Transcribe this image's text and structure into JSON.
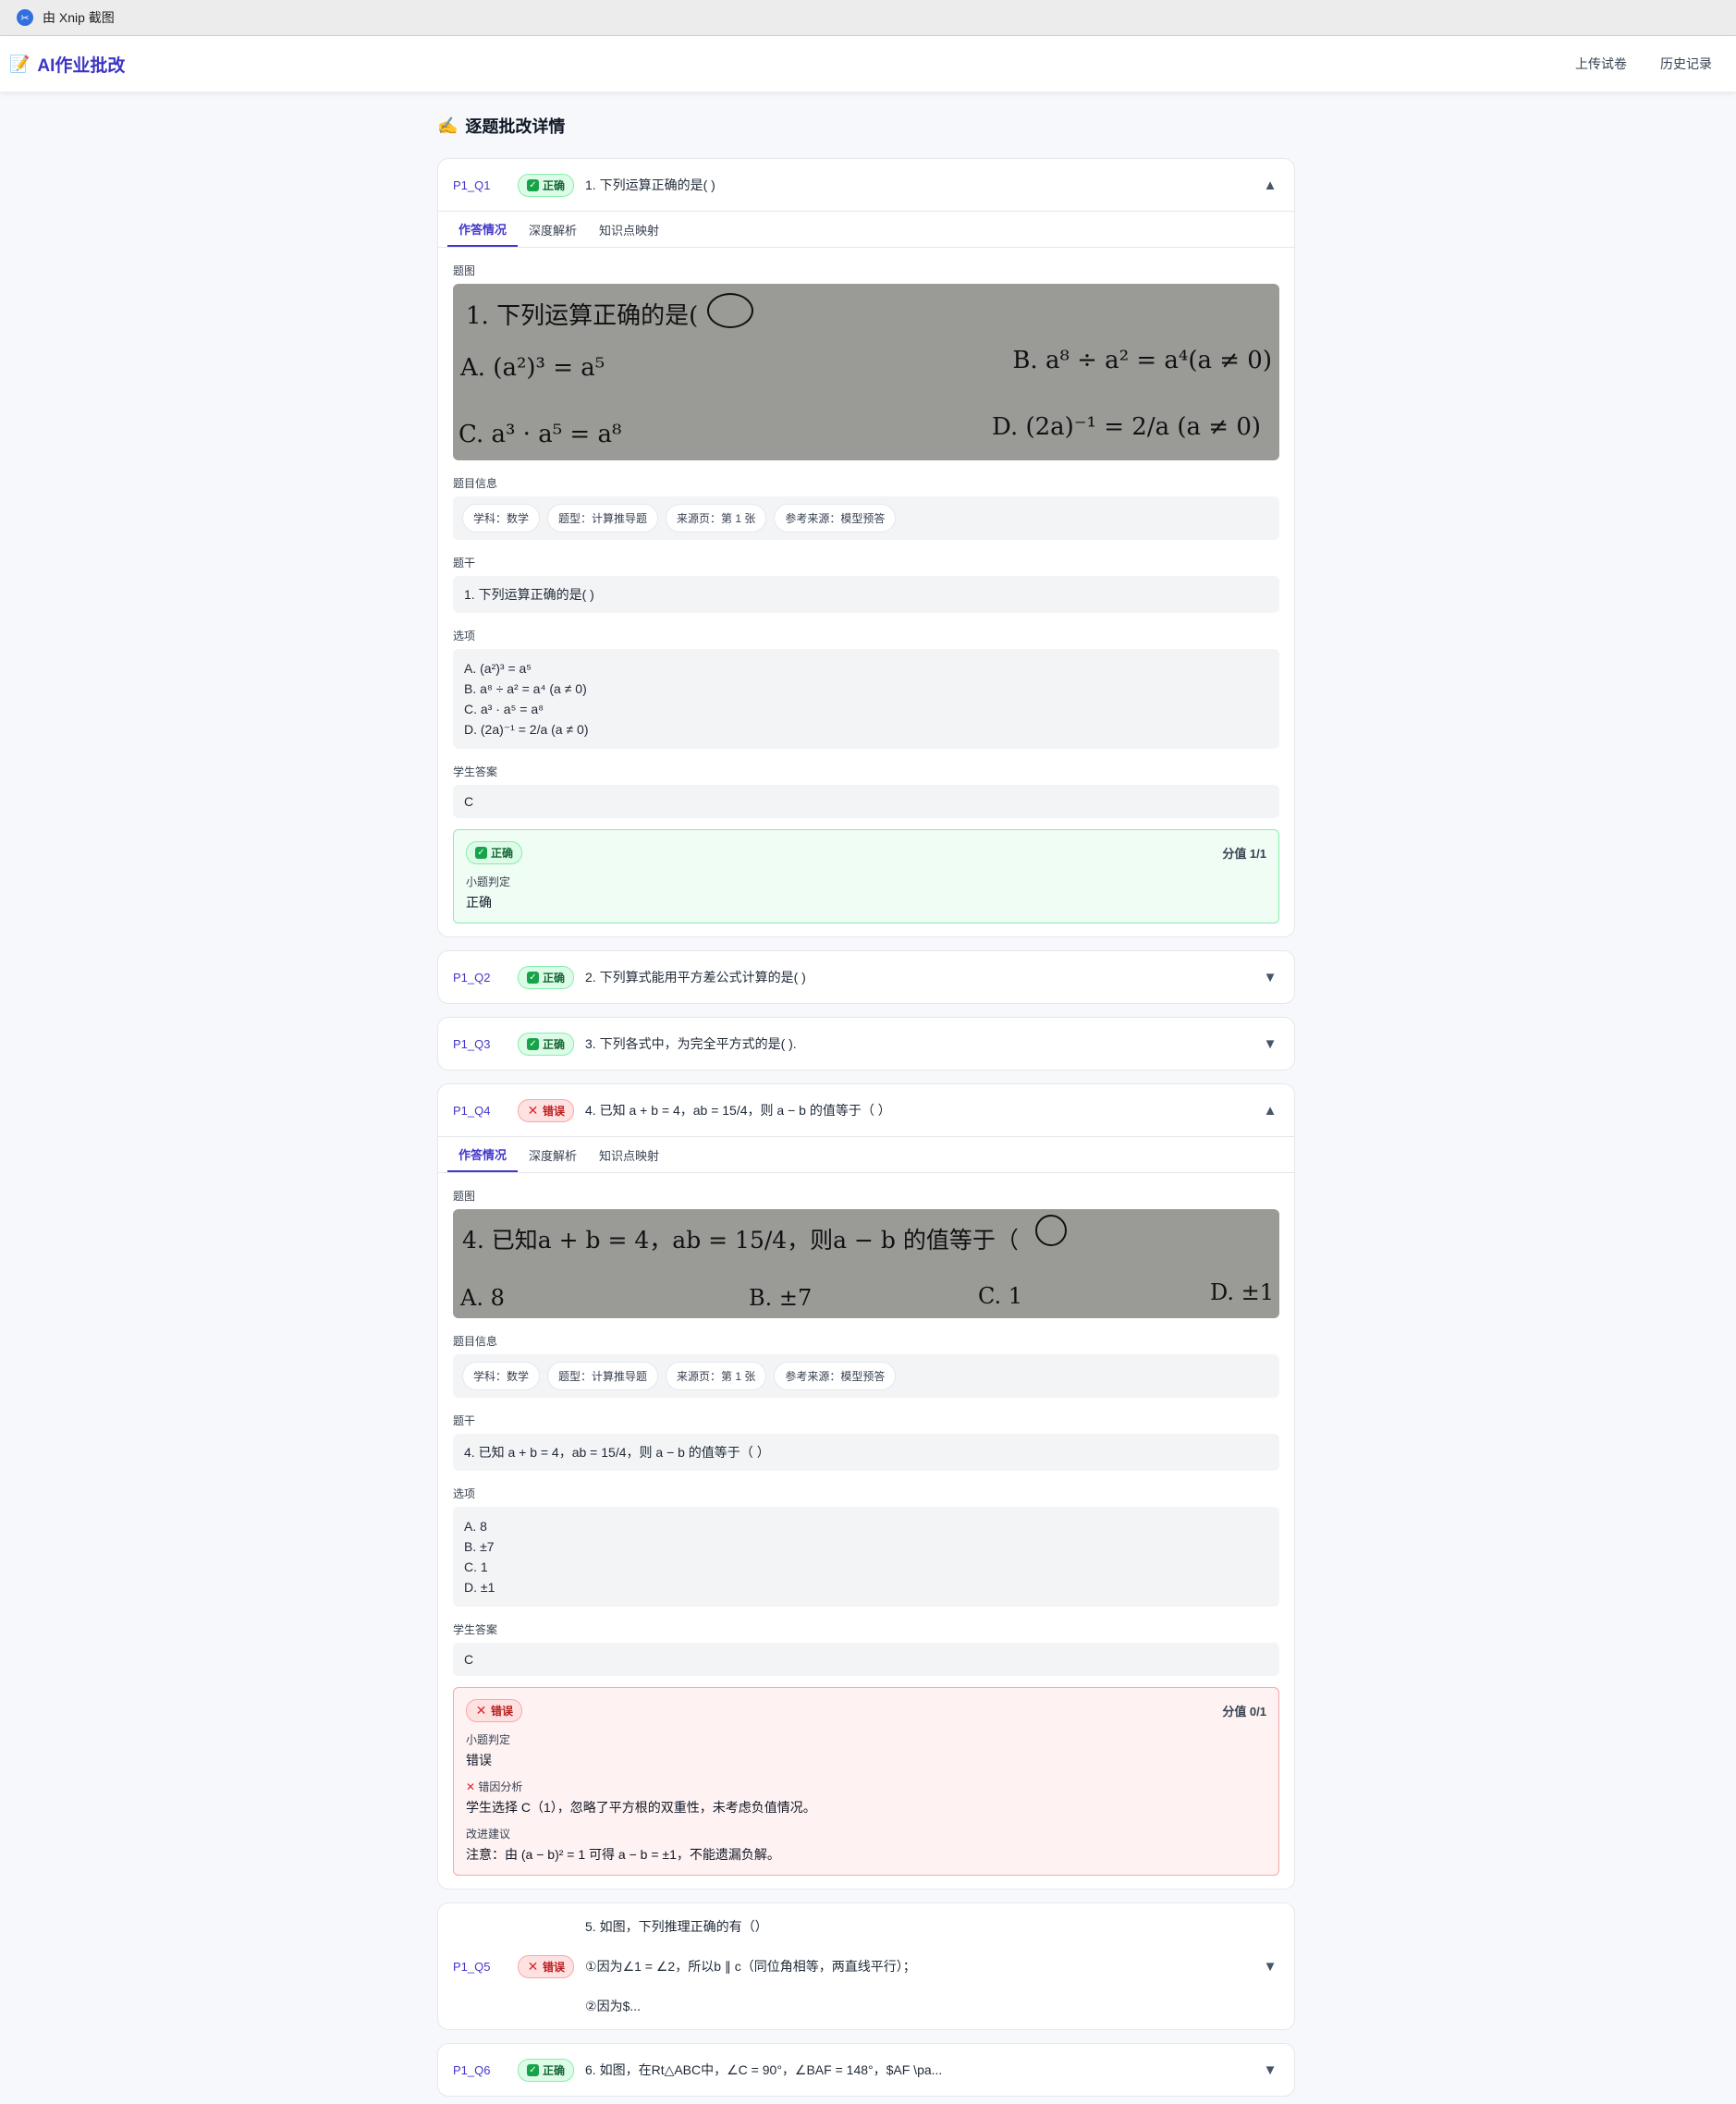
{
  "xnip": {
    "title": "由 Xnip 截图"
  },
  "nav": {
    "brand": "AI作业批改",
    "upload": "上传试卷",
    "history": "历史记录"
  },
  "section": {
    "title": "逐题批改详情"
  },
  "tabs": [
    "作答情况",
    "深度解析",
    "知识点映射"
  ],
  "labels": {
    "image": "题图",
    "info": "题目信息",
    "stem": "题干",
    "options": "选项",
    "answer": "学生答案",
    "judgement": "小题判定",
    "error_analysis": "错因分析",
    "suggestion": "改进建议"
  },
  "info_pills": [
    "学科：数学",
    "题型：计算推导题",
    "来源页：第 1 张",
    "参考来源：模型预答"
  ],
  "questions": {
    "q1": {
      "id": "P1_Q1",
      "status": "正确",
      "title": "1. 下列运算正确的是( )",
      "scan": {
        "line1": "1. 下列运算正确的是(",
        "a": "A. (a²)³ = a⁵",
        "b": "B. a⁸ ÷ a² = a⁴(a ≠ 0)",
        "c": "C. a³ · a⁵ = a⁸",
        "d": "D. (2a)⁻¹ = 2/a (a ≠ 0)"
      },
      "stem": "1. 下列运算正确的是( )",
      "options": [
        "A. (a²)³ = a⁵",
        "B. a⁸ ÷ a² = a⁴ (a ≠ 0)",
        "C. a³ · a⁵ = a⁸",
        "D. (2a)⁻¹ = 2/a (a ≠ 0)"
      ],
      "answer": "C",
      "result": {
        "status": "正确",
        "score": "分值 1/1",
        "judgement": "正确"
      }
    },
    "q2": {
      "id": "P1_Q2",
      "status": "正确",
      "title": "2. 下列算式能用平方差公式计算的是( )"
    },
    "q3": {
      "id": "P1_Q3",
      "status": "正确",
      "title": "3. 下列各式中，为完全平方式的是( )."
    },
    "q4": {
      "id": "P1_Q4",
      "status": "错误",
      "title": "4. 已知 a + b = 4，ab = 15/4，则 a − b 的值等于（ ）",
      "scan": {
        "line1": "4. 已知a + b = 4，ab = 15/4，则a − b 的值等于（",
        "a": "A. 8",
        "b": "B. ±7",
        "c": "C. 1",
        "d": "D. ±1"
      },
      "stem": "4. 已知 a + b = 4，ab = 15/4，则 a − b 的值等于（ ）",
      "options": [
        "A. 8",
        "B. ±7",
        "C. 1",
        "D. ±1"
      ],
      "answer": "C",
      "result": {
        "status": "错误",
        "score": "分值 0/1",
        "judgement": "错误",
        "error_analysis": "学生选择 C（1），忽略了平方根的双重性，未考虑负值情况。",
        "suggestion": "注意：由 (a − b)² = 1 可得 a − b = ±1，不能遗漏负解。"
      }
    },
    "q5": {
      "id": "P1_Q5",
      "status": "错误",
      "lines": [
        "5. 如图，下列推理正确的有（）",
        "①因为∠1 = ∠2，所以b ∥ c（同位角相等，两直线平行）；",
        "②因为$..."
      ]
    },
    "q6": {
      "id": "P1_Q6",
      "status": "正确",
      "title": "6. 如图，在Rt△ABC中，∠C = 90°，∠BAF = 148°，$AF \\pa..."
    }
  }
}
